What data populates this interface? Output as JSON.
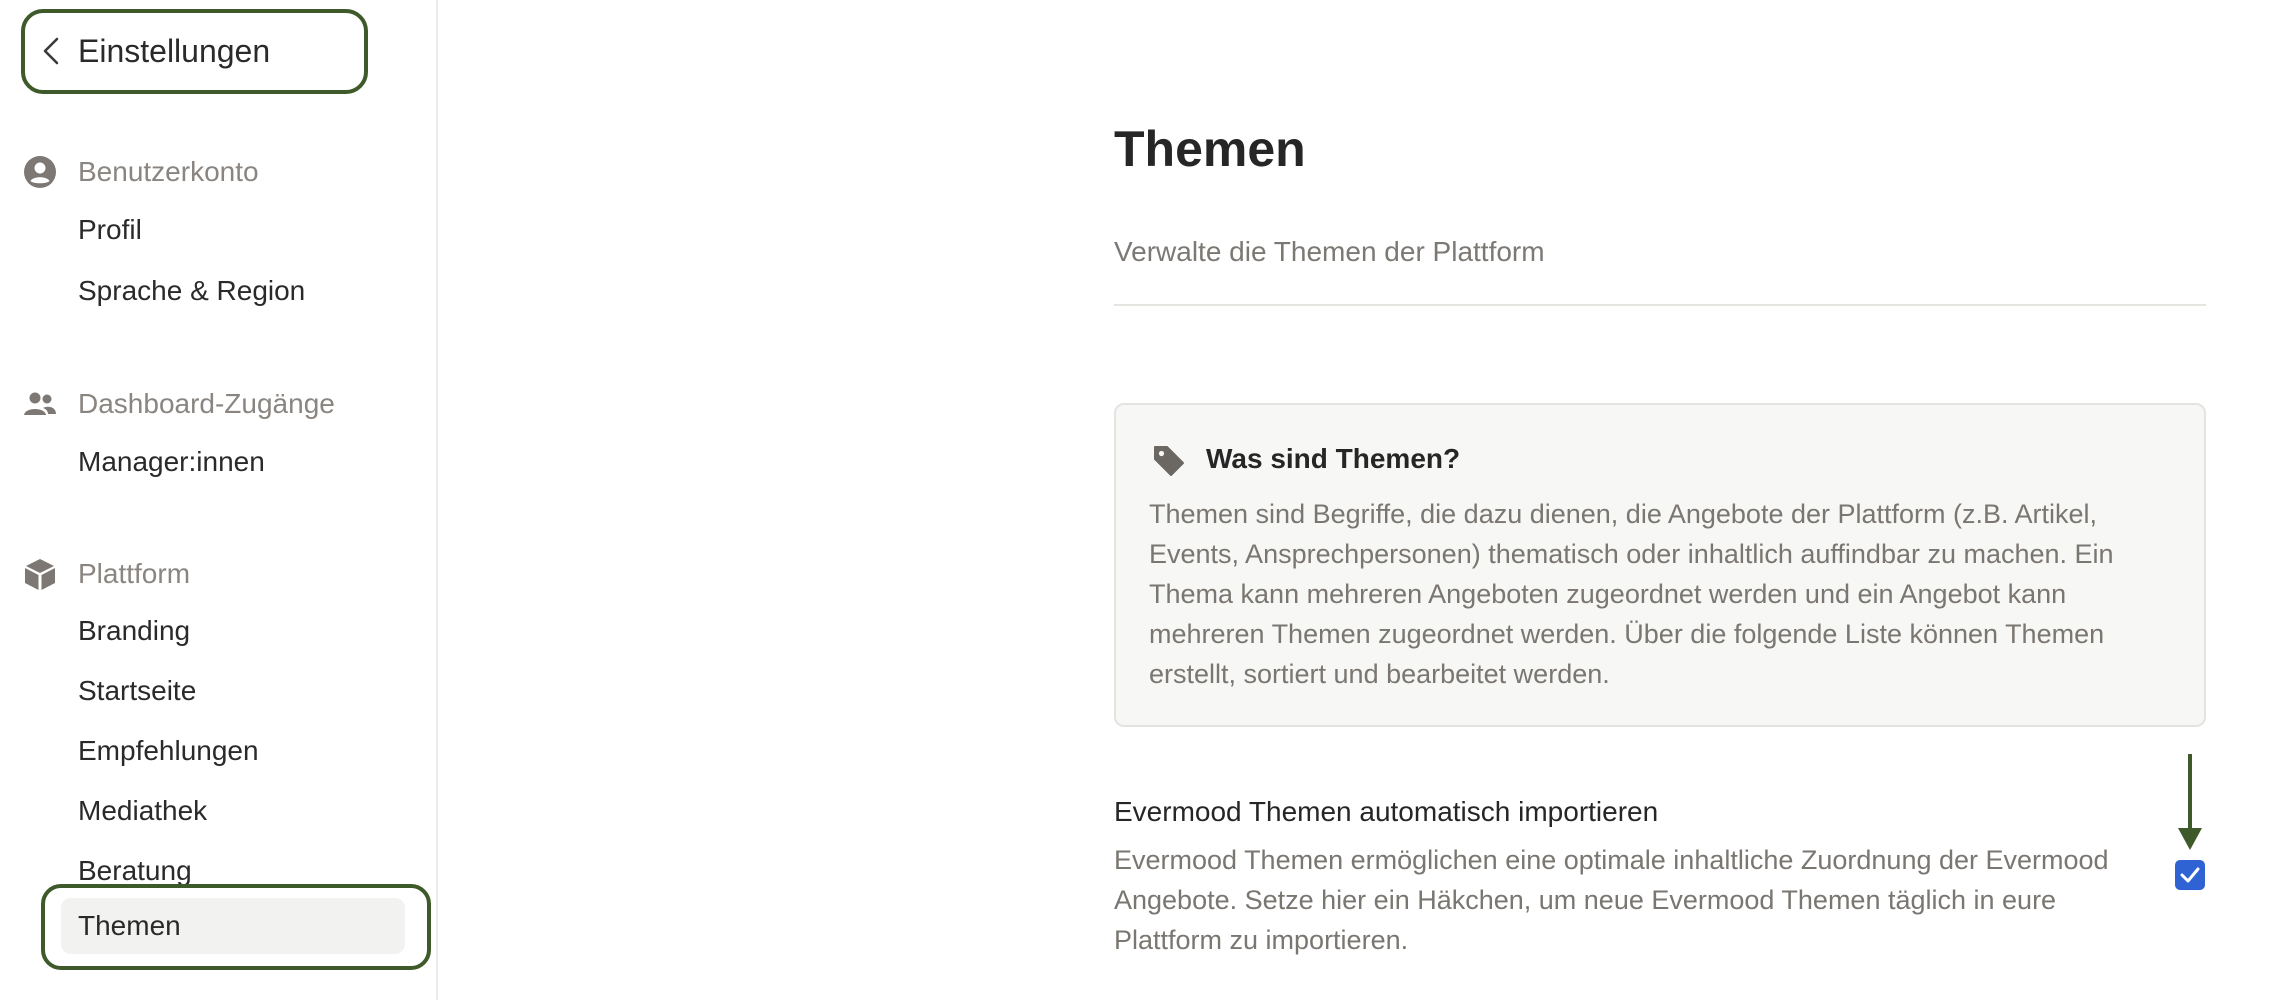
{
  "sidebar": {
    "back_label": "Einstellungen",
    "sections": [
      {
        "label": "Benutzerkonto",
        "icon": "account-circle-icon",
        "items": [
          "Profil",
          "Sprache & Region"
        ]
      },
      {
        "label": "Dashboard-Zugänge",
        "icon": "people-icon",
        "items": [
          "Manager:innen"
        ]
      },
      {
        "label": "Plattform",
        "icon": "cube-icon",
        "items": [
          "Branding",
          "Startseite",
          "Empfehlungen",
          "Mediathek",
          "Beratung",
          "Themen"
        ]
      }
    ],
    "active_item": "Themen"
  },
  "main": {
    "title": "Themen",
    "subtitle": "Verwalte die Themen der Plattform",
    "info_box": {
      "icon": "tag-icon",
      "title": "Was sind Themen?",
      "body": "Themen sind Begriffe, die dazu dienen, die Angebote der Plattform (z.B. Artikel, Events, Ansprechpersonen) thematisch oder inhaltlich auffindbar zu machen. Ein Thema kann mehreren Angeboten zugeordnet werden und ein Angebot kann mehreren Themen zugeordnet werden. Über die folgende Liste können Themen erstellt, sortiert und bearbeitet werden."
    },
    "setting": {
      "title": "Evermood Themen automatisch importieren",
      "description": "Evermood Themen ermöglichen eine optimale inhaltliche Zuordnung der Evermood Angebote. Setze hier ein Häkchen, um neue Evermood Themen täglich in eure Plattform zu importieren.",
      "checked": true
    }
  },
  "colors": {
    "highlight_outline": "#3f5a2a",
    "checkbox_blue": "#2f63d3",
    "muted_text": "#7a7671",
    "section_header": "#8a8580"
  }
}
